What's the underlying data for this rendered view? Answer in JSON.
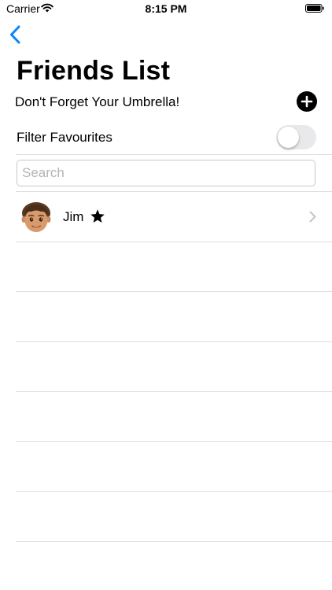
{
  "status_bar": {
    "carrier": "Carrier",
    "time": "8:15 PM"
  },
  "nav": {
    "back_icon": "chevron-left-icon"
  },
  "header": {
    "title": "Friends List",
    "subtitle": "Don't Forget Your Umbrella!",
    "add_icon": "plus-circle-icon"
  },
  "filter": {
    "label": "Filter Favourites",
    "enabled": false
  },
  "search": {
    "placeholder": "Search",
    "value": ""
  },
  "friends": [
    {
      "name": "Jim",
      "favourite": true,
      "avatar_icon": "memoji-avatar-icon"
    }
  ],
  "colors": {
    "accent": "#0a84ff",
    "separator": "#dedee0",
    "toggle_off": "#e9e9eb"
  }
}
